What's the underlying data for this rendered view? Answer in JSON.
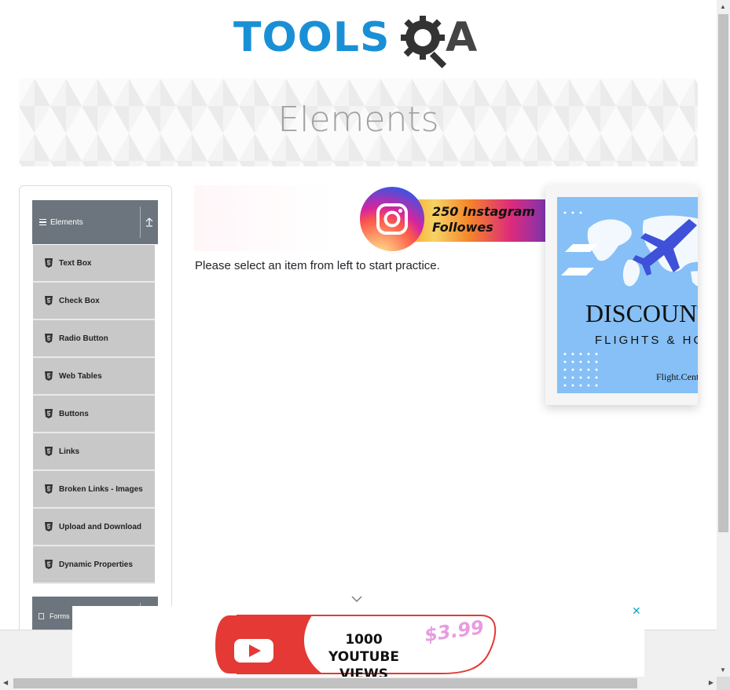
{
  "logo": {
    "tools_text": "TOOLS",
    "qa_letter": "A"
  },
  "banner": {
    "title": "Elements"
  },
  "sidebar": {
    "group_elements_label": "Elements",
    "items": [
      {
        "label": "Text Box"
      },
      {
        "label": "Check Box"
      },
      {
        "label": "Radio Button"
      },
      {
        "label": "Web Tables"
      },
      {
        "label": "Buttons"
      },
      {
        "label": "Links"
      },
      {
        "label": "Broken Links - Images"
      },
      {
        "label": "Upload and Download"
      },
      {
        "label": "Dynamic Properties"
      }
    ],
    "group_forms_label": "Forms"
  },
  "main": {
    "instruction": "Please select an item from left to start practice."
  },
  "ads": {
    "instagram_line1": "250 Instagram",
    "instagram_line2": "Followes",
    "flight_discount": "DISCOUNT",
    "flight_sub": "FLIGHTS & HOT",
    "flight_brand": "Flight.Center",
    "youtube_line1": "1000",
    "youtube_line2": "YOUTUBE VIEWS",
    "youtube_price": "$3.99",
    "close_glyph": "✕"
  },
  "colors": {
    "brand_blue": "#1990d6",
    "group_header": "#6c757d",
    "menu_item": "#c8c8c8"
  }
}
